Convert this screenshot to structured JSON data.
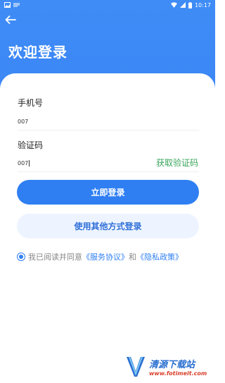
{
  "status_bar": {
    "time": "10:17",
    "battery_color": "#ffffff"
  },
  "header": {
    "title": "欢迎登录",
    "back_icon": "arrow-left-icon",
    "background_color": "#3b86f5"
  },
  "form": {
    "phone_label": "手机号",
    "phone_value": "007",
    "code_label": "验证码",
    "code_value": "007",
    "get_code_label": "获取验证码"
  },
  "actions": {
    "login_label": "立即登录",
    "alt_login_label": "使用其他方式登录"
  },
  "agreement": {
    "checked": true,
    "prefix": "我已阅读并同意",
    "service_link": "《服务协议》",
    "joiner": "和",
    "privacy_link": "《隐私政策》"
  },
  "watermark": {
    "brand": "清源下载站",
    "url": "www.fotimeit.com"
  }
}
